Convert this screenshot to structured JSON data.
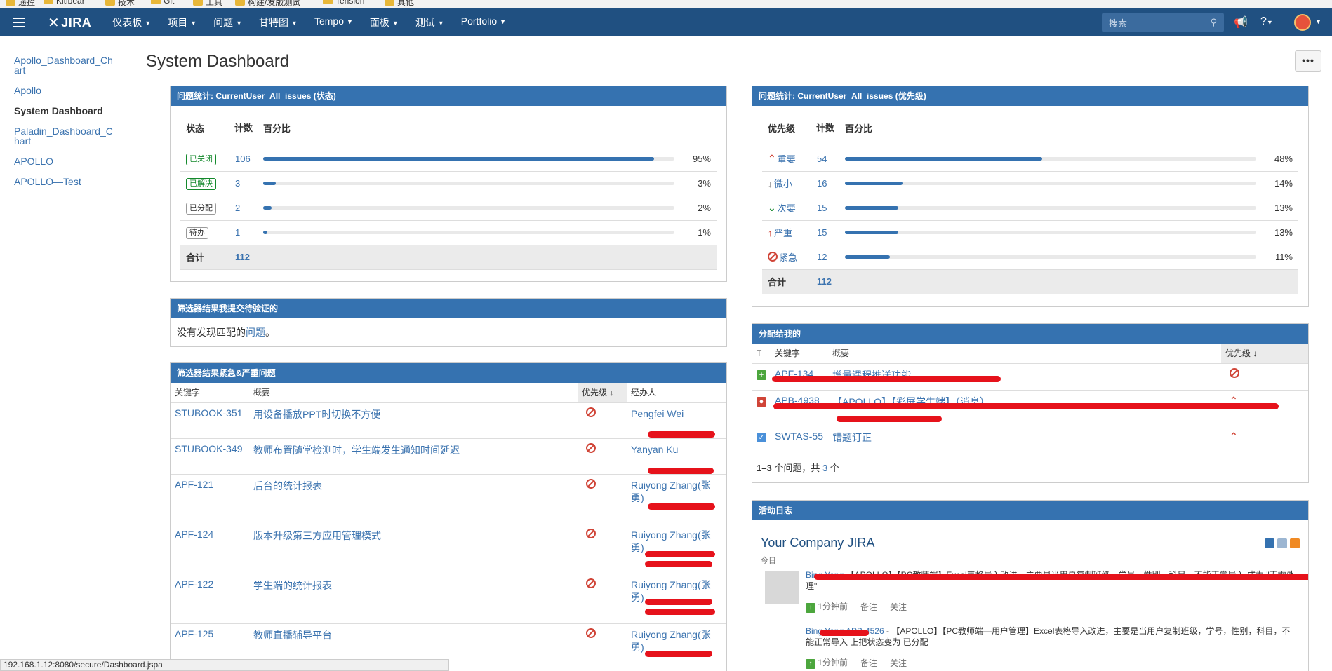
{
  "bookmarks": [
    "遥控",
    "Kitibear",
    "技术",
    "Git",
    "工具",
    "构建/发版测试",
    "Tension",
    "其他"
  ],
  "nav": {
    "logo": "JIRA",
    "menu": [
      {
        "label": "仪表板"
      },
      {
        "label": "项目"
      },
      {
        "label": "问题"
      },
      {
        "label": "甘特图"
      },
      {
        "label": "Tempo"
      },
      {
        "label": "面板"
      },
      {
        "label": "测试"
      },
      {
        "label": "Portfolio"
      }
    ],
    "search_placeholder": "搜索"
  },
  "sidebar": {
    "items": [
      {
        "label": "Apollo_Dashboard_Chart",
        "active": false
      },
      {
        "label": "Apollo",
        "active": false
      },
      {
        "label": "System Dashboard",
        "active": true
      },
      {
        "label": "Paladin_Dashboard_Chart",
        "active": false
      },
      {
        "label": "APOLLO",
        "active": false
      },
      {
        "label": "APOLLO—Test",
        "active": false
      }
    ]
  },
  "page": {
    "title": "System Dashboard",
    "more_label": "•••"
  },
  "status_gadget": {
    "title": "问题统计: CurrentUser_All_issues (状态)",
    "headers": {
      "col1": "状态",
      "col2": "计数",
      "col3": "百分比"
    },
    "rows": [
      {
        "status": "已关闭",
        "count": "106",
        "fraction": 0.95,
        "pct": "95%",
        "color": "green"
      },
      {
        "status": "已解决",
        "count": "3",
        "fraction": 0.03,
        "pct": "3%",
        "color": "green"
      },
      {
        "status": "已分配",
        "count": "2",
        "fraction": 0.02,
        "pct": "2%",
        "color": "gray"
      },
      {
        "status": "待办",
        "count": "1",
        "fraction": 0.01,
        "pct": "1%",
        "color": "gray"
      }
    ],
    "total_label": "合计",
    "total": "112"
  },
  "priority_gadget": {
    "title": "问题统计: CurrentUser_All_issues (优先级)",
    "headers": {
      "col1": "优先级",
      "col2": "计数",
      "col3": "百分比"
    },
    "rows": [
      {
        "priority": "重要",
        "icon": "double-up-icon",
        "count": "54",
        "fraction": 0.48,
        "pct": "48%"
      },
      {
        "priority": "微小",
        "icon": "down-arrow-icon",
        "count": "16",
        "fraction": 0.14,
        "pct": "14%"
      },
      {
        "priority": "次要",
        "icon": "double-down-icon",
        "count": "15",
        "fraction": 0.13,
        "pct": "13%"
      },
      {
        "priority": "严重",
        "icon": "up-arrow-icon",
        "count": "15",
        "fraction": 0.13,
        "pct": "13%"
      },
      {
        "priority": "紧急",
        "icon": "blocker-icon",
        "count": "12",
        "fraction": 0.11,
        "pct": "11%"
      }
    ],
    "total_label": "合计",
    "total": "112"
  },
  "filter_verify": {
    "title": "筛选器结果我提交待验证的",
    "text_before": "没有发现匹配的",
    "link": "问题",
    "text_after": "。"
  },
  "filter_urgent": {
    "title": "筛选器结果紧急&严重问题",
    "headers": {
      "key": "关键字",
      "summary": "概要",
      "priority": "优先级",
      "assignee": "经办人"
    },
    "rows": [
      {
        "key": "STUBOOK-351",
        "summary": "用设备播放PPT时切换不方便",
        "assignee": "Pengfei Wei"
      },
      {
        "key": "STUBOOK-349",
        "summary": "教师布置随堂检测时，学生端发生通知时间延迟",
        "assignee": "Yanyan Ku"
      },
      {
        "key": "APF-121",
        "summary": "后台的统计报表",
        "assignee": "Ruiyong Zhang(张勇)"
      },
      {
        "key": "APF-124",
        "summary": "版本升级第三方应用管理模式",
        "assignee": "Ruiyong Zhang(张勇)"
      },
      {
        "key": "APF-122",
        "summary": "学生端的统计报表",
        "assignee": "Ruiyong Zhang(张勇)"
      },
      {
        "key": "APF-125",
        "summary": "教师直播辅导平台",
        "assignee": "Ruiyong Zhang(张勇)"
      }
    ]
  },
  "assigned": {
    "title": "分配给我的",
    "headers": {
      "type": "T",
      "key": "关键字",
      "summary": "概要",
      "priority": "优先级"
    },
    "rows": [
      {
        "type": "new-feature-icon",
        "key": "APF-134",
        "summary": "增量课程推送功能",
        "priority": "blocker-icon"
      },
      {
        "type": "bug-icon",
        "key": "APB-4938",
        "summary": "【APOLLO】【彩屏学生端】（消息）",
        "priority": "double-up-icon"
      },
      {
        "type": "task-icon",
        "key": "SWTAS-55",
        "summary": "错题订正",
        "priority": "double-up-icon"
      }
    ],
    "footer": {
      "range": "1–3",
      "mid": " 个问题，共 ",
      "count": "3",
      "unit": " 个"
    }
  },
  "activity": {
    "title": "活动日志",
    "heading": "Your Company JIRA",
    "day": "今日",
    "entries": [
      {
        "user": "Bing Yang",
        "text": "【APOLLO】【PC教师端】Excel表格导入改进，主要是当用户复制班级，学号，性别，科目，不能正常导入 成为 \"无需处理\"",
        "time": "1分钟前",
        "comment": "备注",
        "watch": "关注"
      },
      {
        "user": "Bing Yang",
        "key": "APB-4526",
        "text": "- 【APOLLO】【PC教师端—用户管理】Excel表格导入改进，主要是当用户复制班级，学号，性别，科目，不能正常导入 上把状态变为 已分配",
        "time": "1分钟前",
        "comment": "备注",
        "watch": "关注"
      }
    ]
  },
  "statusbar": "192.168.1.12:8080/secure/Dashboard.jspa",
  "colors": {
    "nav": "#205081",
    "gadget_header": "#3572b0",
    "link": "#3b73af",
    "red": "#d04437",
    "green": "#14892c"
  }
}
